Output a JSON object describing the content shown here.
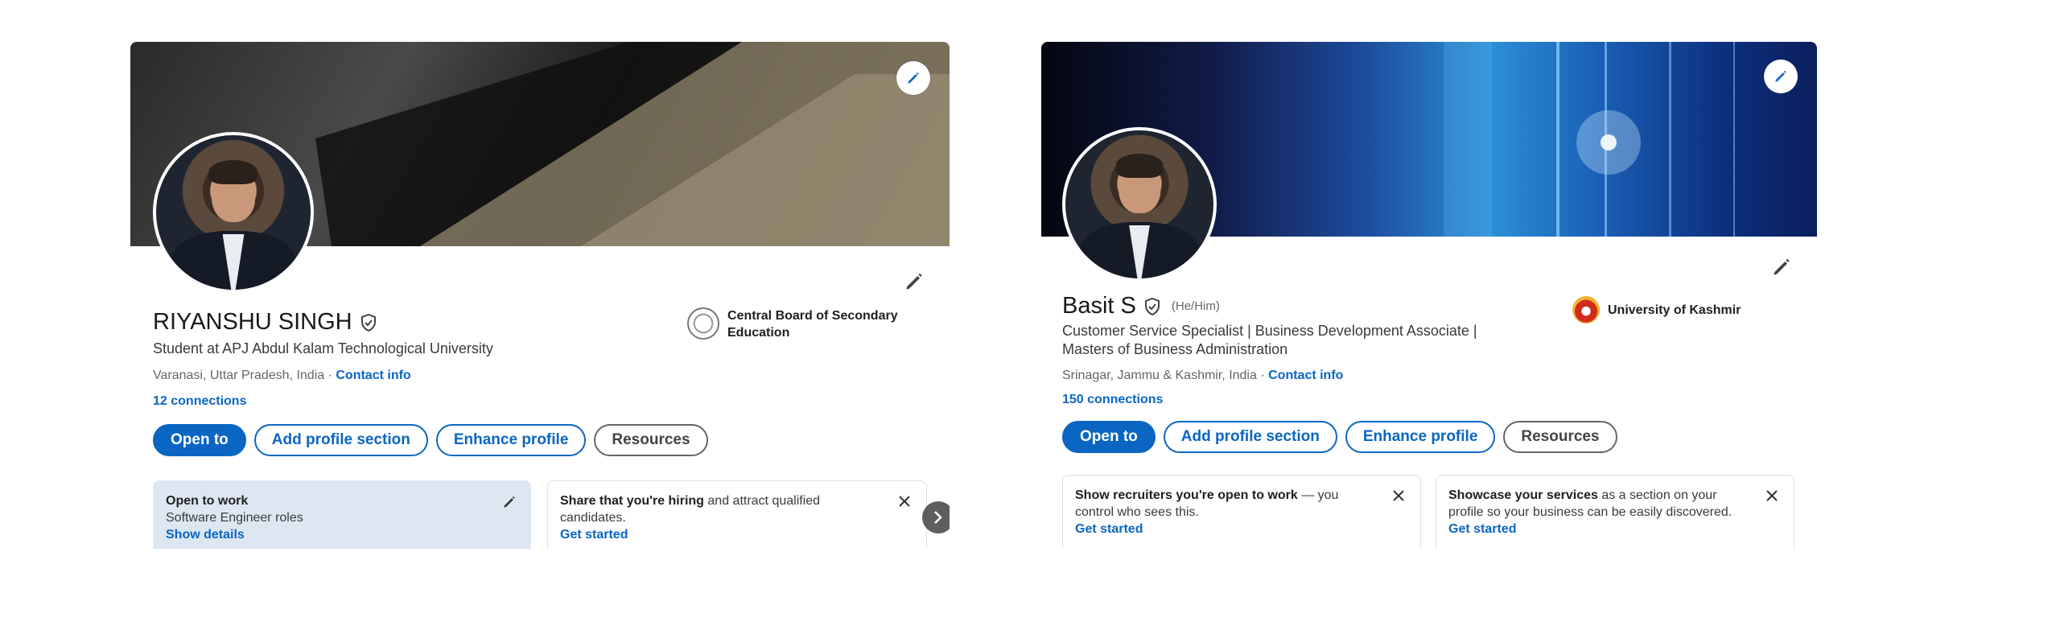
{
  "profiles": [
    {
      "name": "RIYANSHU SINGH",
      "pronouns": "",
      "headline": "Student at APJ Abdul Kalam Technological University",
      "location": "Varanasi, Uttar Pradesh, India",
      "contact_info": "Contact info",
      "separator": " · ",
      "connections": "12 connections",
      "education": "Central Board of Secondary Education",
      "actions": [
        "Open to",
        "Add profile section",
        "Enhance profile",
        "Resources"
      ],
      "open_to_work": {
        "title": "Open to work",
        "roles": "Software Engineer roles",
        "cta": "Show details"
      },
      "hiring_tip": {
        "bold": "Share that you're hiring",
        "rest": " and attract qualified candidates.",
        "cta": "Get started"
      }
    },
    {
      "name": "Basit S",
      "pronouns": "(He/Him)",
      "headline": "Customer Service Specialist | Business Development Associate | Masters of Business Administration",
      "location": "Srinagar, Jammu & Kashmir, India",
      "contact_info": "Contact info",
      "separator": " · ",
      "connections": "150 connections",
      "education": "University of Kashmir",
      "actions": [
        "Open to",
        "Add profile section",
        "Enhance profile",
        "Resources"
      ],
      "recruiters_tip": {
        "bold": "Show recruiters you're open to work",
        "rest": " — you control who sees this.",
        "cta": "Get started"
      },
      "services_tip": {
        "bold": "Showcase your services",
        "rest": " as a section on your profile so your business can be easily discovered.",
        "cta": "Get started"
      }
    }
  ],
  "icons": {
    "edit": "pencil-icon",
    "verified": "verified-shield-icon",
    "close": "close-icon",
    "next": "chevron-right-icon"
  },
  "colors": {
    "accent": "#0a66c2",
    "open_to_work_bg": "#dde7f1"
  }
}
